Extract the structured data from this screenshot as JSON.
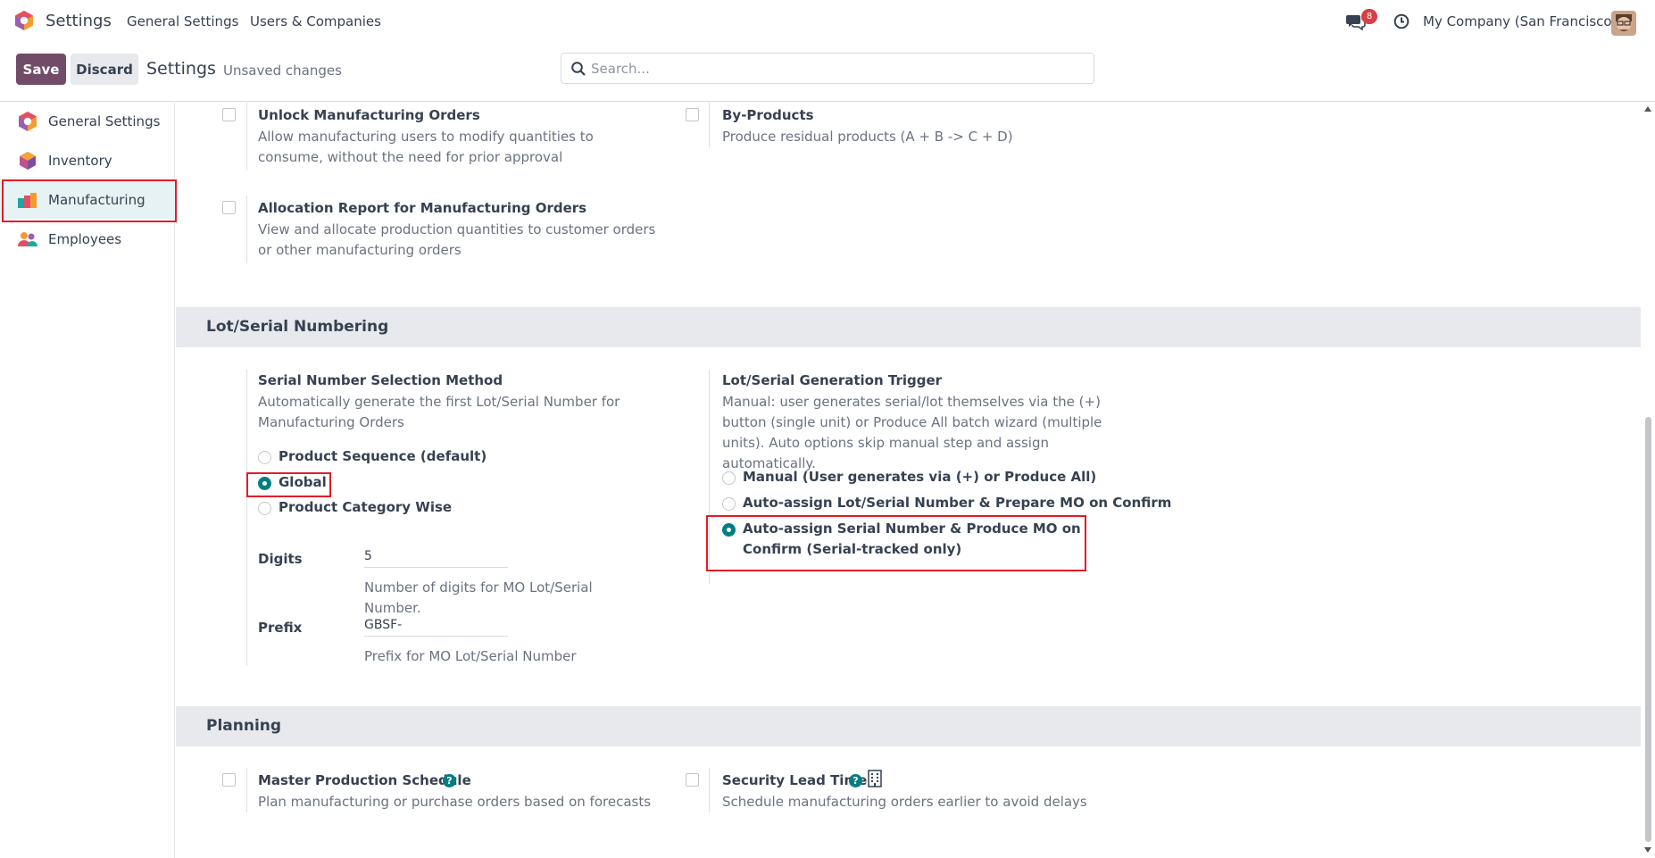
{
  "topbar": {
    "app_title": "Settings",
    "nav": [
      "General Settings",
      "Users & Companies"
    ],
    "chat_badge": "8",
    "company": "My Company (San Francisco)"
  },
  "control": {
    "save_label": "Save",
    "discard_label": "Discard",
    "title": "Settings",
    "status": "Unsaved changes",
    "search_placeholder": "Search..."
  },
  "sidebar": {
    "items": [
      {
        "label": "General Settings",
        "icon": "odoo-logo-icon"
      },
      {
        "label": "Inventory",
        "icon": "inventory-app-icon"
      },
      {
        "label": "Manufacturing",
        "icon": "manufacturing-app-icon",
        "active": true
      },
      {
        "label": "Employees",
        "icon": "employees-app-icon"
      }
    ]
  },
  "settings_top": {
    "unlock": {
      "title": "Unlock Manufacturing Orders",
      "desc": "Allow manufacturing users to modify quantities to consume, without the need for prior approval",
      "checked": false
    },
    "byproducts": {
      "title": "By-Products",
      "desc": "Produce residual products (A + B -> C + D)",
      "checked": false
    },
    "allocation": {
      "title": "Allocation Report for Manufacturing Orders",
      "desc": "View and allocate production quantities to customer orders or other manufacturing orders",
      "checked": false
    }
  },
  "lot_serial": {
    "section_title": "Lot/Serial Numbering",
    "method": {
      "title": "Serial Number Selection Method",
      "desc": "Automatically generate the first Lot/Serial Number for Manufacturing Orders",
      "options": [
        "Product Sequence (default)",
        "Global",
        "Product Category Wise"
      ],
      "selected": "Global"
    },
    "digits": {
      "label": "Digits",
      "value": "5",
      "help": "Number of digits for MO Lot/Serial Number."
    },
    "prefix": {
      "label": "Prefix",
      "value": "GBSF-",
      "help": "Prefix for MO Lot/Serial Number"
    },
    "trigger": {
      "title": "Lot/Serial Generation Trigger",
      "desc": "Manual: user generates serial/lot themselves via the (+) button (single unit) or Produce All batch wizard (multiple units). Auto options skip manual step and assign automatically.",
      "options": [
        "Manual (User generates via (+) or Produce All)",
        "Auto-assign Lot/Serial Number & Prepare MO on Confirm",
        "Auto-assign Serial Number & Produce MO on Confirm (Serial-tracked only)"
      ],
      "selected": "Auto-assign Serial Number & Produce MO on Confirm (Serial-tracked only)"
    }
  },
  "planning": {
    "section_title": "Planning",
    "mps": {
      "title": "Master Production Schedule",
      "desc": "Plan manufacturing or purchase orders based on forecasts",
      "checked": false
    },
    "lead_time": {
      "title": "Security Lead Time",
      "desc": "Schedule manufacturing orders earlier to avoid delays",
      "checked": false
    }
  },
  "colors": {
    "primary": "#714b67",
    "accent": "#017e84",
    "highlight": "#e11d2a",
    "badge": "#d63f45"
  }
}
